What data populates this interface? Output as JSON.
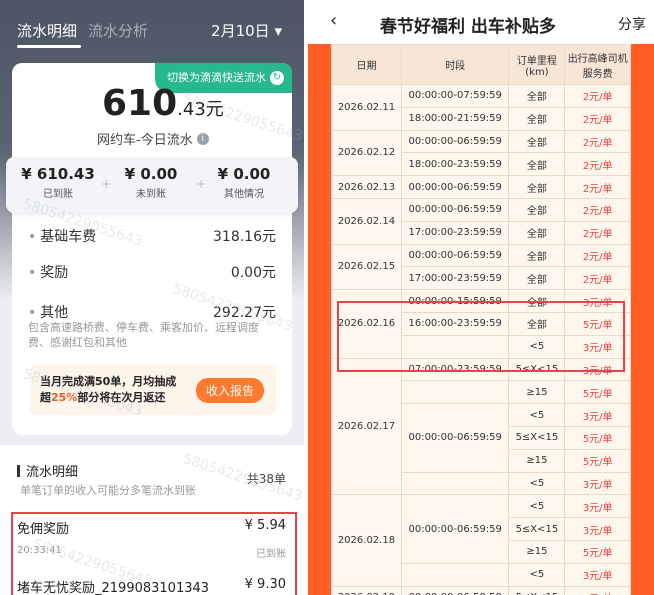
{
  "left": {
    "tabs": [
      "流水明细",
      "流水分析"
    ],
    "date": "2月10日",
    "switch_label": "切换为滴滴快送流水",
    "total_int": "610",
    "total_dec": ".43元",
    "subtitle": "网约车-今日流水",
    "summary": [
      {
        "value": "¥ 610.43",
        "label": "已到账"
      },
      {
        "value": "¥ 0.00",
        "label": "未到账"
      },
      {
        "value": "¥ 0.00",
        "label": "其他情况"
      }
    ],
    "rows": [
      {
        "label": "基础车费",
        "value": "318.16元"
      },
      {
        "label": "奖励",
        "value": "0.00元"
      },
      {
        "label": "其他",
        "value": "292.27元"
      }
    ],
    "note": "包含高速路桥费、停车费、乘客加价、远程调度费、感谢红包和其他",
    "promo_a": "当月完成满50单，月均抽成",
    "promo_b": "超",
    "promo_pct": "25%",
    "promo_c": "部分将在次月返还",
    "promo_btn": "收入报告",
    "list_title": "流水明细",
    "list_sub": "单笔订单的收入可能分多笔流水到账",
    "list_count": "共38单",
    "items": [
      {
        "name": "免佣奖励",
        "amount": "¥ 5.94",
        "time": "20:33:41",
        "status": "已到账"
      },
      {
        "name": "堵车无忧奖励_2199083101343",
        "amount": "¥ 9.30"
      }
    ],
    "watermark": "58054229055643"
  },
  "right": {
    "back": "‹",
    "title": "春节好福利 出车补贴多",
    "share": "分享",
    "headers": [
      "日期",
      "时段",
      "订单里程(km)",
      "出行高峰司机服务费"
    ],
    "colors": {
      "accent": "#ff5f24",
      "red": "#e64545"
    },
    "rows": [
      {
        "date": "2026.02.11",
        "span": 2,
        "period": "00:00:00-07:59:59",
        "km": "全部",
        "fee": "2元/单"
      },
      {
        "period": "18:00:00-21:59:59",
        "km": "全部",
        "fee": "2元/单"
      },
      {
        "date": "2026.02.12",
        "span": 2,
        "period": "00:00:00-06:59:59",
        "km": "全部",
        "fee": "2元/单"
      },
      {
        "period": "18:00:00-23:59:59",
        "km": "全部",
        "fee": "2元/单"
      },
      {
        "date": "2026.02.13",
        "span": 1,
        "period": "00:00:00-06:59:59",
        "km": "全部",
        "fee": "2元/单"
      },
      {
        "date": "2026.02.14",
        "span": 2,
        "period": "00:00:00-06:59:59",
        "km": "全部",
        "fee": "2元/单"
      },
      {
        "period": "17:00:00-23:59:59",
        "km": "全部",
        "fee": "2元/单"
      },
      {
        "date": "2026.02.15",
        "span": 2,
        "period": "00:00:00-06:59:59",
        "km": "全部",
        "fee": "2元/单"
      },
      {
        "period": "17:00:00-23:59:59",
        "km": "全部",
        "fee": "2元/单"
      },
      {
        "date": "2026.02.16",
        "span": 3,
        "period": "00:00:00-15:59:59",
        "km": "全部",
        "fee": "3元/单"
      },
      {
        "period": "16:00:00-23:59:59",
        "km": "全部",
        "fee": "5元/单"
      },
      {
        "period": "",
        "km": "<5",
        "fee": "3元/单"
      },
      {
        "date": "2026.02.17",
        "span": 6,
        "period": "07:00:00-23:59:59",
        "km": "5≤X<15",
        "fee": "3元/单"
      },
      {
        "period": "",
        "km": "≥15",
        "fee": "5元/单"
      },
      {
        "period": "00:00:00-06:59:59",
        "pspan": 3,
        "km": "<5",
        "fee": "3元/单"
      },
      {
        "km": "5≤X<15",
        "fee": "5元/单"
      },
      {
        "km": "≥15",
        "fee": "5元/单"
      },
      {
        "period": "",
        "km": "<5",
        "fee": "3元/单"
      },
      {
        "date": "2026.02.18",
        "span": 4,
        "period": "00:00:00-06:59:59",
        "pspan": 3,
        "km": "<5",
        "fee": "3元/单"
      },
      {
        "km": "5≤X<15",
        "fee": "3元/单"
      },
      {
        "km": "≥15",
        "fee": "5元/单"
      },
      {
        "period": "",
        "km": "<5",
        "fee": "3元/单"
      },
      {
        "date": "2026.02.19",
        "span": 1,
        "period": "00:00:00-06:59:59",
        "km": "5≤X<15",
        "fee": "3元/单"
      }
    ]
  }
}
